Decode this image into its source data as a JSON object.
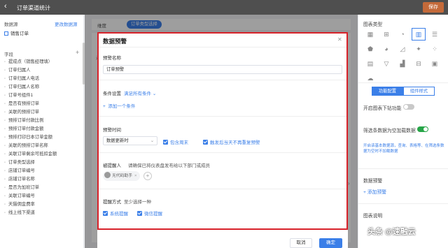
{
  "header": {
    "title": "订单渠道统计",
    "save_label": "保存",
    "back_icon": "chevron-left-icon"
  },
  "left_panel": {
    "datasource_label": "数据源",
    "change_datasource_label": "更改数据源",
    "datasource_item": "销售订单",
    "fields_label": "字段",
    "add_icon": "plus-icon",
    "fields": [
      "提成点（销售经理填）",
      "订单归属人",
      "订单归属人电话",
      "订单归属人名称",
      "订单号组件1",
      "是否有预排订单",
      "关联的预排订单",
      "预排订单付款比例",
      "预排订单付款金额",
      "预排打印日本订单金额",
      "关联的预排订单名称",
      "关联订单剩余可抵扣金额",
      "订单类型选择",
      "店铺订单编号",
      "店铺订单名称",
      "是否为加班订单",
      "关联订单编号",
      "天猫佣金费率",
      "线上线下渠道"
    ]
  },
  "center": {
    "dimension_label": "维度",
    "dimension_chip": "订单类型选择",
    "filter_label": "过"
  },
  "modal": {
    "title": "数据预警",
    "close_icon": "close-icon",
    "warning_name_label": "预警名称",
    "warning_name_value": "订单预警",
    "condition_label": "条件设置",
    "condition_mode": "满足所有条件",
    "add_condition": "添加一个条件",
    "time_label": "预警时间",
    "time_select": "数据更新时",
    "include_weekend": "包含周末",
    "no_repeat": "触发后当天不再重复预警",
    "remind_label": "被提醒人",
    "remind_hint": "请确保已将仪表盘发布给以下部门或成员",
    "member_name": "无代码助手",
    "method_label": "提醒方式",
    "method_hint": "至少选择一种",
    "system_remind": "系统提醒",
    "wechat_remind": "微信提醒",
    "cancel_label": "取消",
    "ok_label": "确定"
  },
  "right_panel": {
    "chart_type_label": "图表类型",
    "chart_icons": [
      "table-icon",
      "grid-icon",
      "gauge-icon",
      "bar-chart-icon",
      "column-chart-icon",
      "map-icon",
      "pie-chart-icon",
      "line-chart-icon",
      "radar-icon",
      "scatter-icon",
      "treemap-icon",
      "funnel-icon",
      "area-chart-icon",
      "pivot-icon",
      "card-icon",
      "wordcloud-icon"
    ],
    "tab_function": "功能配置",
    "tab_style": "组件样式",
    "drill_down_label": "开启图表下钻功能",
    "filter_null_label": "筛选条数据为空加载数据",
    "filter_hint": "开启该基本数据源，查询、表格等、在筛选条数据为空时不加载数据",
    "data_warning_label": "数据预警",
    "add_warning": "添加预警",
    "chart_desc_label": "图表说明"
  },
  "watermark": "头条 @速融云",
  "colors": {
    "accent": "#3b7fe8",
    "highlight_border": "#d8222a",
    "save_button": "#c46a3a",
    "toggle_on": "#27a548"
  }
}
